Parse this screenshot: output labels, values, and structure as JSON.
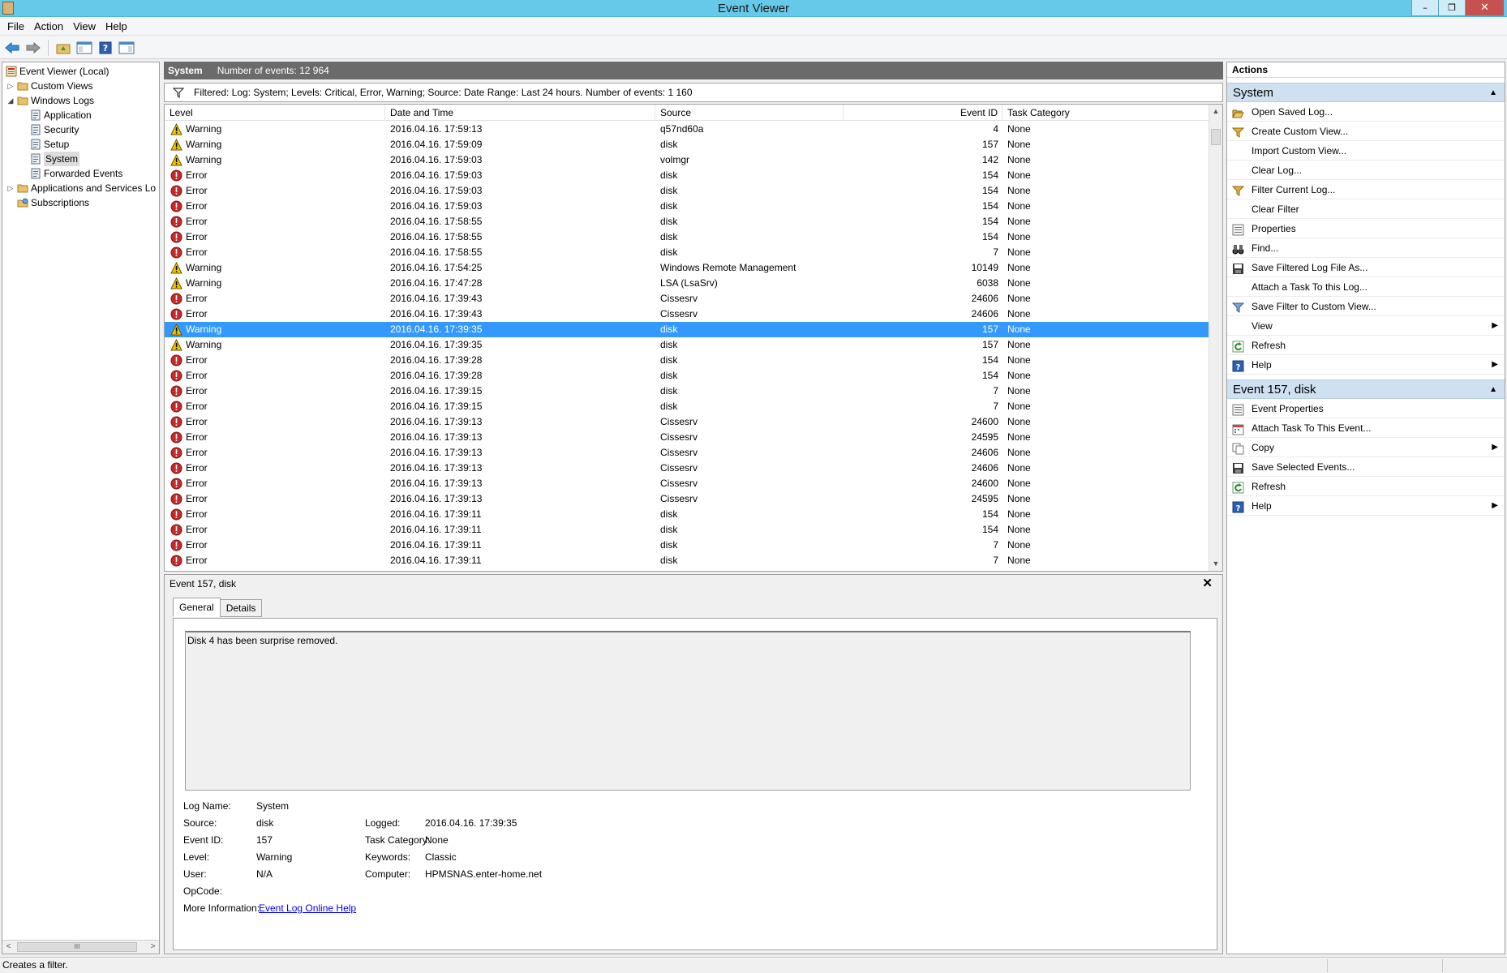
{
  "window": {
    "title": "Event Viewer",
    "minimize": "–",
    "restore": "❐",
    "close": "✕"
  },
  "menu": [
    "File",
    "Action",
    "View",
    "Help"
  ],
  "toolbar": {
    "icons": [
      "back-arrow-icon",
      "forward-arrow-icon",
      "up-folder-icon",
      "show-hide-tree-icon",
      "help-icon",
      "show-hide-action-pane-icon"
    ]
  },
  "tree": [
    {
      "label": "Event Viewer (Local)",
      "level": 0,
      "expander": "",
      "icon": "event-viewer-icon"
    },
    {
      "label": "Custom Views",
      "level": 1,
      "expander": "▷",
      "icon": "folder-icon"
    },
    {
      "label": "Windows Logs",
      "level": 1,
      "expander": "◢",
      "icon": "folder-icon"
    },
    {
      "label": "Application",
      "level": 2,
      "expander": "",
      "icon": "log-icon"
    },
    {
      "label": "Security",
      "level": 2,
      "expander": "",
      "icon": "log-icon"
    },
    {
      "label": "Setup",
      "level": 2,
      "expander": "",
      "icon": "log-icon"
    },
    {
      "label": "System",
      "level": 2,
      "expander": "",
      "icon": "log-icon",
      "selected": true
    },
    {
      "label": "Forwarded Events",
      "level": 2,
      "expander": "",
      "icon": "log-icon"
    },
    {
      "label": "Applications and Services Lo",
      "level": 1,
      "expander": "▷",
      "icon": "folder-icon"
    },
    {
      "label": "Subscriptions",
      "level": 1,
      "expander": "",
      "icon": "subscriptions-icon"
    }
  ],
  "left_scroll": {
    "left": "<",
    "thumb": "III",
    "right": ">"
  },
  "log_header": {
    "name": "System",
    "count": "Number of events: 12 964"
  },
  "filter": {
    "text": "Filtered: Log: System; Levels: Critical, Error, Warning; Source: Date Range: Last 24 hours. Number of events: 1 160"
  },
  "columns": [
    "Level",
    "Date and Time",
    "Source",
    "Event ID",
    "Task Category"
  ],
  "events": [
    {
      "level": "Warning",
      "date": "2016.04.16. 17:59:13",
      "source": "q57nd60a",
      "id": "4",
      "category": "None"
    },
    {
      "level": "Warning",
      "date": "2016.04.16. 17:59:09",
      "source": "disk",
      "id": "157",
      "category": "None"
    },
    {
      "level": "Warning",
      "date": "2016.04.16. 17:59:03",
      "source": "volmgr",
      "id": "142",
      "category": "None"
    },
    {
      "level": "Error",
      "date": "2016.04.16. 17:59:03",
      "source": "disk",
      "id": "154",
      "category": "None"
    },
    {
      "level": "Error",
      "date": "2016.04.16. 17:59:03",
      "source": "disk",
      "id": "154",
      "category": "None"
    },
    {
      "level": "Error",
      "date": "2016.04.16. 17:59:03",
      "source": "disk",
      "id": "154",
      "category": "None"
    },
    {
      "level": "Error",
      "date": "2016.04.16. 17:58:55",
      "source": "disk",
      "id": "154",
      "category": "None"
    },
    {
      "level": "Error",
      "date": "2016.04.16. 17:58:55",
      "source": "disk",
      "id": "154",
      "category": "None"
    },
    {
      "level": "Error",
      "date": "2016.04.16. 17:58:55",
      "source": "disk",
      "id": "7",
      "category": "None"
    },
    {
      "level": "Warning",
      "date": "2016.04.16. 17:54:25",
      "source": "Windows Remote Management",
      "id": "10149",
      "category": "None"
    },
    {
      "level": "Warning",
      "date": "2016.04.16. 17:47:28",
      "source": "LSA (LsaSrv)",
      "id": "6038",
      "category": "None"
    },
    {
      "level": "Error",
      "date": "2016.04.16. 17:39:43",
      "source": "Cissesrv",
      "id": "24606",
      "category": "None"
    },
    {
      "level": "Error",
      "date": "2016.04.16. 17:39:43",
      "source": "Cissesrv",
      "id": "24606",
      "category": "None"
    },
    {
      "level": "Warning",
      "date": "2016.04.16. 17:39:35",
      "source": "disk",
      "id": "157",
      "category": "None",
      "selected": true
    },
    {
      "level": "Warning",
      "date": "2016.04.16. 17:39:35",
      "source": "disk",
      "id": "157",
      "category": "None"
    },
    {
      "level": "Error",
      "date": "2016.04.16. 17:39:28",
      "source": "disk",
      "id": "154",
      "category": "None"
    },
    {
      "level": "Error",
      "date": "2016.04.16. 17:39:28",
      "source": "disk",
      "id": "154",
      "category": "None"
    },
    {
      "level": "Error",
      "date": "2016.04.16. 17:39:15",
      "source": "disk",
      "id": "7",
      "category": "None"
    },
    {
      "level": "Error",
      "date": "2016.04.16. 17:39:15",
      "source": "disk",
      "id": "7",
      "category": "None"
    },
    {
      "level": "Error",
      "date": "2016.04.16. 17:39:13",
      "source": "Cissesrv",
      "id": "24600",
      "category": "None"
    },
    {
      "level": "Error",
      "date": "2016.04.16. 17:39:13",
      "source": "Cissesrv",
      "id": "24595",
      "category": "None"
    },
    {
      "level": "Error",
      "date": "2016.04.16. 17:39:13",
      "source": "Cissesrv",
      "id": "24606",
      "category": "None"
    },
    {
      "level": "Error",
      "date": "2016.04.16. 17:39:13",
      "source": "Cissesrv",
      "id": "24606",
      "category": "None"
    },
    {
      "level": "Error",
      "date": "2016.04.16. 17:39:13",
      "source": "Cissesrv",
      "id": "24600",
      "category": "None"
    },
    {
      "level": "Error",
      "date": "2016.04.16. 17:39:13",
      "source": "Cissesrv",
      "id": "24595",
      "category": "None"
    },
    {
      "level": "Error",
      "date": "2016.04.16. 17:39:11",
      "source": "disk",
      "id": "154",
      "category": "None"
    },
    {
      "level": "Error",
      "date": "2016.04.16. 17:39:11",
      "source": "disk",
      "id": "154",
      "category": "None"
    },
    {
      "level": "Error",
      "date": "2016.04.16. 17:39:11",
      "source": "disk",
      "id": "7",
      "category": "None"
    },
    {
      "level": "Error",
      "date": "2016.04.16. 17:39:11",
      "source": "disk",
      "id": "7",
      "category": "None"
    }
  ],
  "grid_scroll": {
    "up": "▲",
    "down": "▼"
  },
  "detail": {
    "title": "Event 157, disk",
    "close": "✕",
    "tabs": [
      "General",
      "Details"
    ],
    "description": "Disk 4 has been surprise removed.",
    "fields": {
      "log_name_label": "Log Name:",
      "log_name": "System",
      "source_label": "Source:",
      "source": "disk",
      "logged_label": "Logged:",
      "logged": "2016.04.16. 17:39:35",
      "event_id_label": "Event ID:",
      "event_id": "157",
      "task_category_label": "Task Category:",
      "task_category": "None",
      "level_label": "Level:",
      "level": "Warning",
      "keywords_label": "Keywords:",
      "keywords": "Classic",
      "user_label": "User:",
      "user": "N/A",
      "computer_label": "Computer:",
      "computer": "HPMSNAS.enter-home.net",
      "opcode_label": "OpCode:",
      "more_info_label": "More Information:",
      "more_info_link": "Event Log Online Help"
    }
  },
  "actions": {
    "header": "Actions",
    "groups": [
      {
        "title": "System",
        "caret": "▲",
        "items": [
          {
            "label": "Open Saved Log...",
            "icon": "open-folder-icon"
          },
          {
            "label": "Create Custom View...",
            "icon": "filter-icon"
          },
          {
            "label": "Import Custom View...",
            "icon": ""
          },
          {
            "label": "Clear Log...",
            "icon": ""
          },
          {
            "label": "Filter Current Log...",
            "icon": "filter-icon"
          },
          {
            "label": "Clear Filter",
            "icon": ""
          },
          {
            "label": "Properties",
            "icon": "properties-icon"
          },
          {
            "label": "Find...",
            "icon": "binoculars-icon"
          },
          {
            "label": "Save Filtered Log File As...",
            "icon": "save-icon"
          },
          {
            "label": "Attach a Task To this Log...",
            "icon": ""
          },
          {
            "label": "Save Filter to Custom View...",
            "icon": "filter-save-icon"
          },
          {
            "label": "View",
            "icon": "",
            "submenu": "▶"
          },
          {
            "label": "Refresh",
            "icon": "refresh-icon"
          },
          {
            "label": "Help",
            "icon": "help-icon",
            "submenu": "▶"
          }
        ]
      },
      {
        "title": "Event 157, disk",
        "caret": "▲",
        "items": [
          {
            "label": "Event Properties",
            "icon": "properties-icon"
          },
          {
            "label": "Attach Task To This Event...",
            "icon": "task-icon"
          },
          {
            "label": "Copy",
            "icon": "copy-icon",
            "submenu": "▶"
          },
          {
            "label": "Save Selected Events...",
            "icon": "save-icon"
          },
          {
            "label": "Refresh",
            "icon": "refresh-icon"
          },
          {
            "label": "Help",
            "icon": "help-icon",
            "submenu": "▶"
          }
        ]
      }
    ]
  },
  "status": {
    "text": "Creates a filter."
  },
  "colors": {
    "titlebar": "#66c9ea",
    "selection": "#3399ff",
    "header_bar": "#6b6b6b",
    "group_header": "#cfe0f0",
    "error_red": "#c42b2b",
    "warning_yellow": "#f5c400",
    "link": "#0000ee"
  }
}
